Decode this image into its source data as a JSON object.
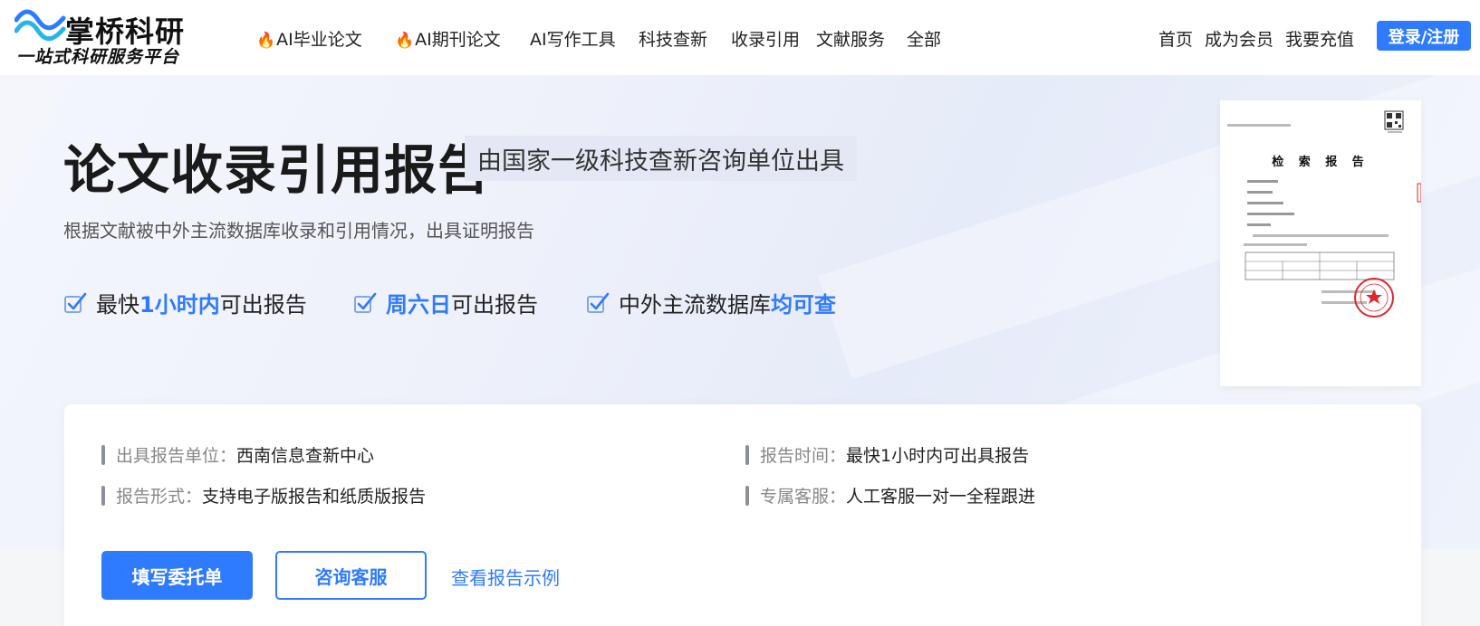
{
  "brand": {
    "name": "掌桥科研",
    "slogan": "一站式科研服务平台"
  },
  "nav": {
    "items": [
      {
        "label": "AI毕业论文",
        "hot": true
      },
      {
        "label": "AI期刊论文",
        "hot": true
      },
      {
        "label": "AI写作工具",
        "hot": false
      },
      {
        "label": "科技查新",
        "hot": false
      },
      {
        "label": "收录引用",
        "hot": false
      },
      {
        "label": "文献服务",
        "hot": false
      },
      {
        "label": "全部",
        "hot": false
      }
    ],
    "links": [
      "首页",
      "成为会员",
      "我要充值"
    ],
    "login_label": "登录/注册"
  },
  "hero": {
    "title": "论文收录引用报告",
    "badge": "由国家一级科技查新咨询单位出具",
    "description": "根据文献被中外主流数据库收录和引用情况，出具证明报告",
    "features": [
      {
        "prefix": "最快",
        "highlight": "1小时内",
        "suffix": "可出报告"
      },
      {
        "prefix": "",
        "highlight": "周六日",
        "suffix": "可出报告"
      },
      {
        "prefix": "中外主流数据库",
        "highlight": "均可查",
        "suffix": ""
      }
    ]
  },
  "report_preview": {
    "title": "检 索 报 告"
  },
  "info": {
    "rows": [
      {
        "label": "出具报告单位：",
        "value": "西南信息查新中心"
      },
      {
        "label": "报告时间：",
        "value": "最快1小时内可出具报告"
      },
      {
        "label": "报告形式：",
        "value": "支持电子版报告和纸质版报告"
      },
      {
        "label": "专属客服：",
        "value": "人工客服一对一全程跟进"
      }
    ]
  },
  "actions": {
    "primary": "填写委托单",
    "secondary": "咨询客服",
    "link": "查看报告示例"
  },
  "colors": {
    "accent": "#2f7bff",
    "fire": "#ff5a1f",
    "stamp": "#e0262b"
  },
  "icons": [
    "logo-waves-icon",
    "fire-icon",
    "checkbox-icon",
    "qr-code-icon",
    "stamp-icon"
  ]
}
